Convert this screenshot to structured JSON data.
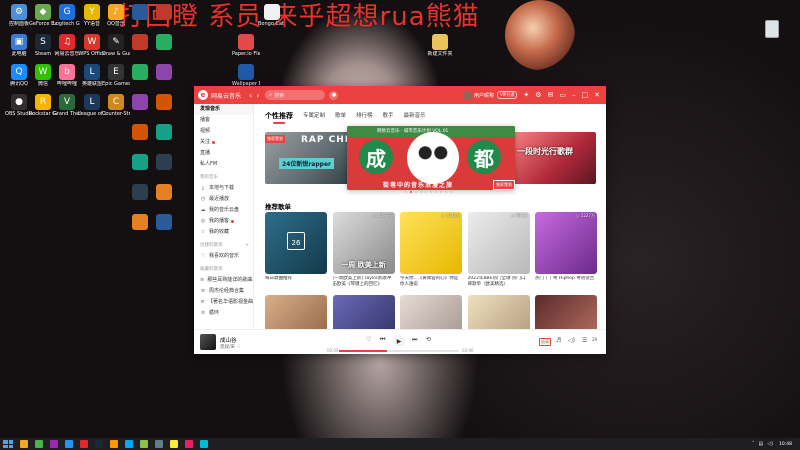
{
  "overlay_text": "打回瞪 系员 来乎超想rua熊猫",
  "desktop": {
    "icons": [
      {
        "label": "控制面板",
        "color": "#4a90d9",
        "glyph": "⚙"
      },
      {
        "label": "GeForce Experience",
        "color": "#6aa84f",
        "glyph": "◆"
      },
      {
        "label": "Logitech G HUB",
        "color": "#1e6fd9",
        "glyph": "G"
      },
      {
        "label": "YY语音",
        "color": "#e6b800",
        "glyph": "Y"
      },
      {
        "label": "QQ音乐",
        "color": "#f5a623",
        "glyph": "♪"
      },
      {
        "label": "此电脑",
        "color": "#3a7bd5",
        "glyph": "▣"
      },
      {
        "label": "Steam",
        "color": "#1b2838",
        "glyph": "S"
      },
      {
        "label": "网易云音乐",
        "color": "#e0282e",
        "glyph": "♫"
      },
      {
        "label": "WPS Office",
        "color": "#d9372b",
        "glyph": "W"
      },
      {
        "label": "Draw & Guess",
        "color": "#222",
        "glyph": "✎"
      },
      {
        "label": "腾讯QQ",
        "color": "#1a8cff",
        "glyph": "Q"
      },
      {
        "label": "微信",
        "color": "#2dc100",
        "glyph": "W"
      },
      {
        "label": "哔哩哔哩",
        "color": "#fb7299",
        "glyph": "b"
      },
      {
        "label": "英雄联盟",
        "color": "#1a4a7a",
        "glyph": "L"
      },
      {
        "label": "Epic Games Launcher",
        "color": "#333",
        "glyph": "E"
      },
      {
        "label": "OBS Studio",
        "color": "#302e31",
        "glyph": "●"
      },
      {
        "label": "Rockstar Games",
        "color": "#f5b400",
        "glyph": "R"
      },
      {
        "label": "Grand Theft Auto V",
        "color": "#2a6a3a",
        "glyph": "V"
      },
      {
        "label": "League of Legends",
        "color": "#1b3a5a",
        "glyph": "L"
      },
      {
        "label": "Counter-Strike Global Off.",
        "color": "#d08a1a",
        "glyph": "C"
      }
    ],
    "folder_icons": [
      {
        "label": "Bongo Cat Mver",
        "color": "#f0f0f0"
      },
      {
        "label": "Paper.io Fleece",
        "color": "#e24a4a"
      },
      {
        "label": "Wallpaper Engine",
        "color": "#1e5aa8"
      },
      {
        "label": "新建文件夹",
        "color": "#e8c25a"
      }
    ]
  },
  "app": {
    "name": "网易云音乐",
    "search_placeholder": "搜索",
    "user": {
      "name": "用户昵称",
      "vip": "VIP开通"
    },
    "sidebar": {
      "items": [
        {
          "label": "发现音乐",
          "active": true,
          "icon": ""
        },
        {
          "label": "播客",
          "icon": ""
        },
        {
          "label": "视频",
          "icon": ""
        },
        {
          "label": "关注",
          "icon": "",
          "dot": true
        },
        {
          "label": "直播",
          "icon": ""
        },
        {
          "label": "私人FM",
          "icon": ""
        }
      ],
      "my_music_head": "我的音乐",
      "my_music": [
        {
          "label": "本地与下载",
          "icon": "⤓"
        },
        {
          "label": "最近播放",
          "icon": "◷"
        },
        {
          "label": "我的音乐云盘",
          "icon": "☁"
        },
        {
          "label": "我的播客",
          "icon": "◎",
          "dot": true
        },
        {
          "label": "我的收藏",
          "icon": "☆"
        }
      ],
      "created_head": "创建的歌单",
      "created": [
        {
          "label": "我喜欢的音乐",
          "icon": "♡"
        }
      ],
      "collected_head": "收藏的歌单",
      "collected": [
        {
          "label": "那些耳熟能详的歌曲…",
          "icon": "≡"
        },
        {
          "label": "周杰伦经典合集",
          "icon": "≡"
        },
        {
          "label": "【著名华语影视金曲",
          "icon": "≡"
        },
        {
          "label": "循环",
          "icon": "≡"
        }
      ]
    },
    "tabs": [
      "个性推荐",
      "专属定制",
      "歌单",
      "排行榜",
      "歌手",
      "最新音乐"
    ],
    "banners": {
      "left": {
        "tag": "独家策划",
        "title": "RAP CHI",
        "sub": "24位新锐rapper"
      },
      "center": {
        "strip": "网易云音乐 · 城市音乐计划 VOL.01",
        "left_char": "成",
        "right_char": "都",
        "slogan": "街巷中的音乐浪漫之旅",
        "tag": "独家策划"
      },
      "right": {
        "title": "一段时光行歌群"
      }
    },
    "dots": 10,
    "active_dot": 1,
    "recommend_title": "推荐歌单",
    "playlists": [
      {
        "caption": "每日歌曲推荐",
        "play_count": "",
        "overlay": "",
        "kind": "daily",
        "date": "26",
        "color": "linear-gradient(135deg,#2d6f8a,#14384a)"
      },
      {
        "caption": "[一周欧美上新] Taylor新歌冲击欧美《琴键上的回忆》",
        "play_count": "▷ 1195万",
        "overlay": "一周 欧美上新",
        "color": "linear-gradient(135deg,#dcdcdc,#8a8a8a)"
      },
      {
        "caption": "今天你...《黄霄雲的心》你是你人誰说",
        "play_count": "▷ 1036万",
        "overlay": "",
        "color": "linear-gradient(135deg,#ffe25a,#e6b800)"
      },
      {
        "caption": "2022年BBE热门全球 热门口碑歌单（欧美精选）",
        "play_count": "▷ 893万",
        "overlay": "",
        "color": "linear-gradient(135deg,#ececec,#b8b8b8)"
      },
      {
        "caption": "热门丨丨粤 Hiphop 粤语饶舌",
        "play_count": "▷ 5227万",
        "overlay": "",
        "color": "linear-gradient(135deg,#c86ae0,#6a2a8a)"
      },
      {
        "caption": "",
        "play_count": "",
        "overlay": "",
        "color": "linear-gradient(135deg,#d8b08a,#8a5a3a)"
      },
      {
        "caption": "",
        "play_count": "",
        "overlay": "",
        "color": "linear-gradient(135deg,#6a6ab8,#2a2a5a)"
      },
      {
        "caption": "",
        "play_count": "",
        "overlay": "",
        "color": "linear-gradient(135deg,#e6dcd6,#9a8a84)"
      },
      {
        "caption": "",
        "play_count": "",
        "overlay": "",
        "color": "linear-gradient(135deg,#f0e0c0,#a89070)"
      },
      {
        "caption": "",
        "play_count": "",
        "overlay": "",
        "color": "linear-gradient(135deg,#5a2a2a,#c47a6a)"
      }
    ],
    "player": {
      "song": "成山谷",
      "artist": "黑奴/宋 ♡",
      "current": "00:00",
      "total": "03:06",
      "progress": 0.4,
      "quality": "极高",
      "count": "29"
    }
  },
  "taskbar": {
    "clock": "10:48",
    "apps": [
      "#f5a623",
      "#4caf50",
      "#9c27b0",
      "#2196f3",
      "#e0282e",
      "#1b2838",
      "#ff9800",
      "#03a9f4",
      "#8bc34a",
      "#607d8b",
      "#ffeb3b",
      "#e91e63",
      "#00bcd4"
    ]
  }
}
